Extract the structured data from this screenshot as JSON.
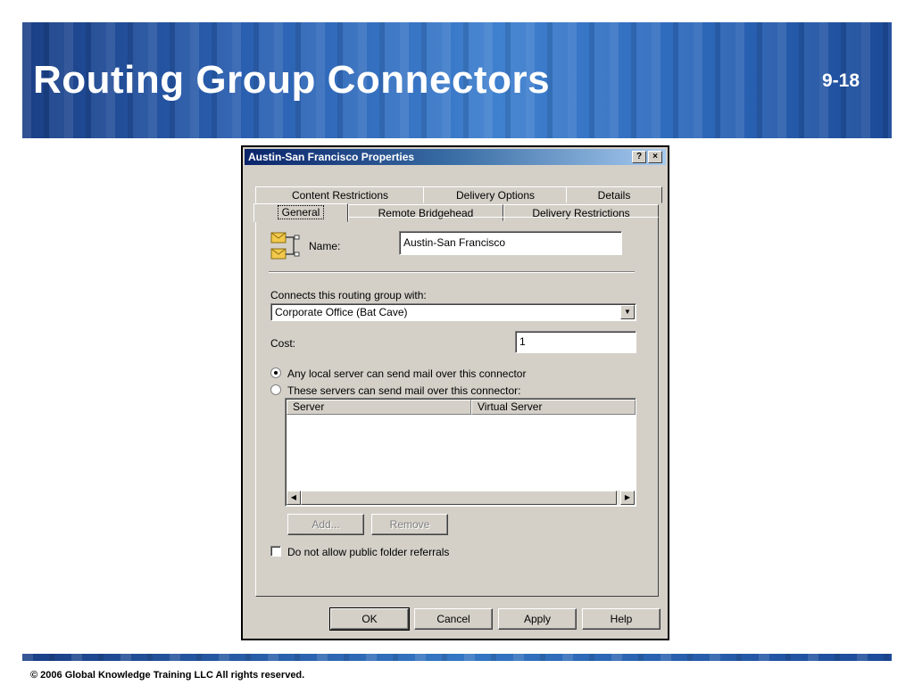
{
  "slide": {
    "title": "Routing Group Connectors",
    "number": "9-18",
    "copyright": "© 2006 Global Knowledge Training LLC All rights reserved."
  },
  "dialog": {
    "title": "Austin-San Francisco Properties",
    "help_label": "?",
    "close_label": "×",
    "tabs_row1": [
      "Content Restrictions",
      "Delivery Options",
      "Details"
    ],
    "tabs_row2": [
      "General",
      "Remote Bridgehead",
      "Delivery Restrictions"
    ],
    "active_tab": "General",
    "name_label": "Name:",
    "name_value": "Austin-San Francisco",
    "connects_label": "Connects this routing group with:",
    "connects_value": "Corporate Office (Bat Cave)",
    "cost_label": "Cost:",
    "cost_value": "1",
    "radio_any": "Any local server can send mail over this connector",
    "radio_these": "These servers can send mail over this connector:",
    "radio_selected": "any",
    "columns": [
      "Server",
      "Virtual Server"
    ],
    "rows": [],
    "add_label": "Add...",
    "remove_label": "Remove",
    "checkbox_label": "Do not allow public folder referrals",
    "checkbox_checked": false,
    "ok_label": "OK",
    "cancel_label": "Cancel",
    "apply_label": "Apply",
    "help_button_label": "Help",
    "icon": "connector-envelopes-icon"
  },
  "colors": {
    "header_blue": "#2a5fb0",
    "dialog_face": "#d4d0c8",
    "titlebar_start": "#0a246a",
    "titlebar_end": "#a6caf0"
  }
}
